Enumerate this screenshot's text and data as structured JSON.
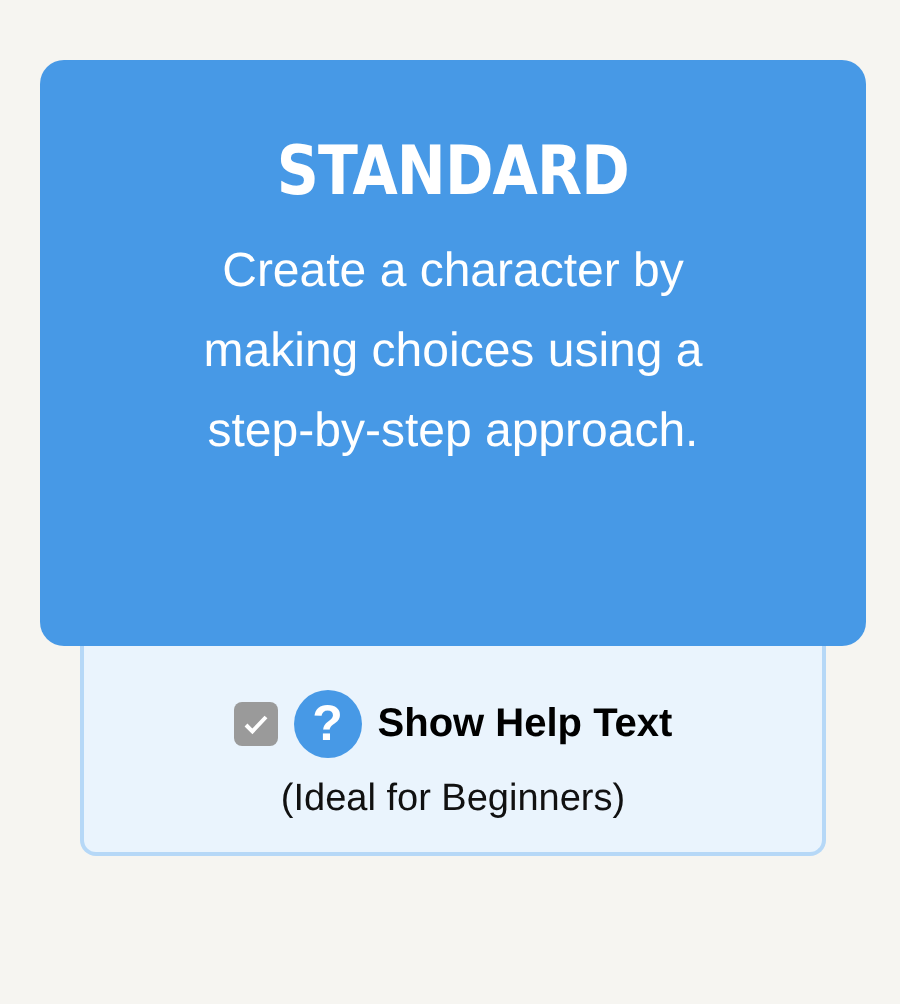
{
  "card": {
    "title": "STANDARD",
    "description": "Create a character by making choices using a step-by-step approach."
  },
  "option": {
    "label": "Show Help Text",
    "note": "(Ideal for Beginners)",
    "checked": true,
    "disabled": true,
    "help_icon": "?"
  }
}
